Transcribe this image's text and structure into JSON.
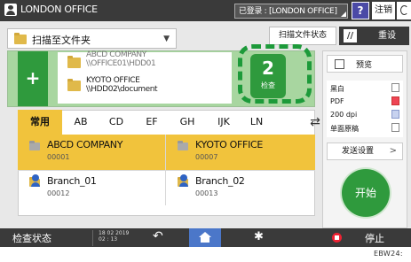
{
  "topbar": {
    "title": "LONDON OFFICE",
    "login_status": "已登录 : [LONDON OFFICE]",
    "help_label": "?",
    "logout_label": "注销"
  },
  "dest_select": {
    "value": "扫描至文件夹"
  },
  "toolbar": {
    "scan_status_label": "扫描文件状态",
    "reset_label": "重设"
  },
  "dest_box": {
    "add_label": "+",
    "entries": [
      {
        "line1": "ABCD COMPANY",
        "line2": "\\\\OFFICE01\\HDD01"
      },
      {
        "line1": "KYOTO OFFICE",
        "line2": "\\\\HDD02\\document"
      }
    ],
    "check_count": "2",
    "check_label": "检查"
  },
  "addressbook": {
    "tabs": [
      "常用",
      "AB",
      "CD",
      "EF",
      "GH",
      "IJK",
      "LN"
    ],
    "active_tab": "常用",
    "entries": [
      {
        "name": "ABCD COMPANY",
        "number": "00001",
        "type": "folder",
        "selected": true
      },
      {
        "name": "KYOTO OFFICE",
        "number": "00007",
        "type": "folder",
        "selected": true
      },
      {
        "name": "Branch_01",
        "number": "00012",
        "type": "user",
        "selected": false
      },
      {
        "name": "Branch_02",
        "number": "00013",
        "type": "user",
        "selected": false
      }
    ]
  },
  "right_panel": {
    "preview_label": "预览",
    "settings": [
      "黑白",
      "PDF",
      "200 dpi",
      "单面原稿"
    ],
    "send_settings_label": "发送设置",
    "start_label": "开始"
  },
  "bottombar": {
    "check_status_label": "检查状态",
    "date": "18 02 2019",
    "time": "02 : 13",
    "stop_label": "停止"
  },
  "figure_code": "EBW24:",
  "colors": {
    "topbar": "#3a3a3a",
    "accent_green": "#2f9a3d",
    "selected_yellow": "#f1c33c",
    "home_blue": "#4b77c9",
    "stop_red": "#e22233"
  }
}
